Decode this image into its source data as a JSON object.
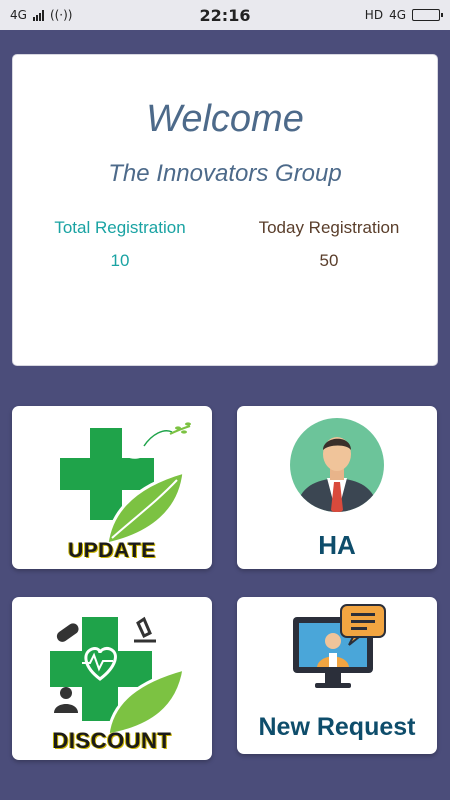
{
  "statusbar": {
    "network_left": "4G",
    "network_right": "4G",
    "hd": "HD",
    "time": "22:16"
  },
  "welcome": {
    "title": "Welcome",
    "org_name": "The Innovators Group",
    "total_label": "Total Registration",
    "total_value": "10",
    "today_label": "Today Registration",
    "today_value": "50"
  },
  "tiles": [
    {
      "label": "UPDATE",
      "icon": "medical-cross-dove-icon"
    },
    {
      "label": "HA",
      "icon": "businessman-avatar-icon"
    },
    {
      "label": "DISCOUNT",
      "icon": "medical-cross-heart-icon"
    },
    {
      "label": "New Request",
      "icon": "video-consult-icon"
    }
  ],
  "colors": {
    "background": "#4b4d7a",
    "title_text": "#4d6a8a",
    "total_text": "#1aa3a3",
    "today_text": "#5a3e2b",
    "tile_label": "#0e4d6b",
    "cross_green": "#1fa34a"
  }
}
